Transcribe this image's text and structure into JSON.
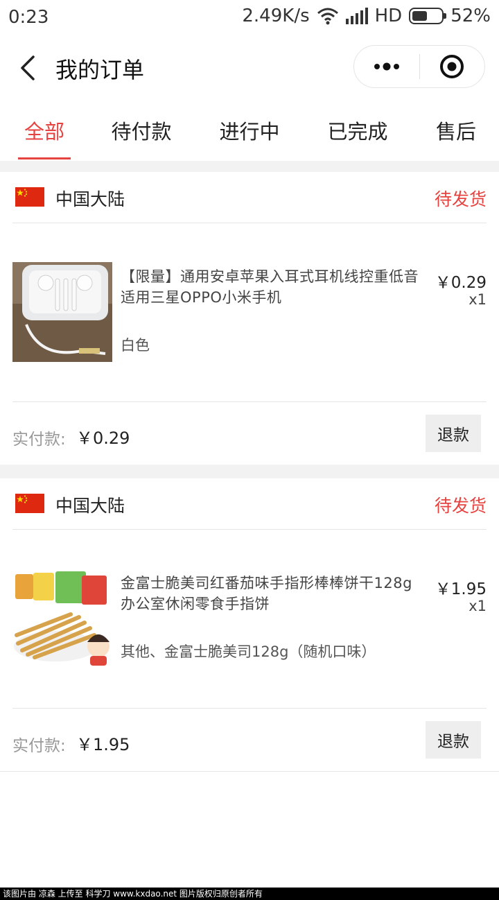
{
  "status_bar": {
    "time": "0:23",
    "network_speed": "2.49K/s",
    "network_type": "HD",
    "battery_level": 0.52,
    "battery_text": "52%"
  },
  "nav": {
    "title": "我的订单",
    "back_icon": "chevron-left-icon",
    "menu_icon": "more-dots-icon",
    "close_icon": "target-circle-icon"
  },
  "tabs": [
    {
      "label": "全部",
      "active": true
    },
    {
      "label": "待付款",
      "active": false
    },
    {
      "label": "进行中",
      "active": false
    },
    {
      "label": "已完成",
      "active": false
    },
    {
      "label": "售后",
      "active": false
    }
  ],
  "colors": {
    "accent": "#e64340",
    "flag_red": "#de2910",
    "flag_yellow": "#ffde00",
    "separator": "#f2f2f2"
  },
  "orders": [
    {
      "region": "中国大陆",
      "status": "待发货",
      "item": {
        "title": "【限量】通用安卓苹果入耳式耳机线控重低音适用三星OPPO小米手机",
        "sku": "白色",
        "price": "￥0.29",
        "qty": "x1"
      },
      "paid_label": "实付款:",
      "paid_value": "￥0.29",
      "refund_label": "退款"
    },
    {
      "region": "中国大陆",
      "status": "待发货",
      "item": {
        "title": "金富士脆美司红番茄味手指形棒棒饼干128g办公室休闲零食手指饼",
        "sku": "其他、金富士脆美司128g（随机口味）",
        "price": "￥1.95",
        "qty": "x1"
      },
      "paid_label": "实付款:",
      "paid_value": "￥1.95",
      "refund_label": "退款"
    }
  ],
  "watermark": "该图片由 凉森 上传至 科学刀 www.kxdao.net 图片版权归原创者所有"
}
